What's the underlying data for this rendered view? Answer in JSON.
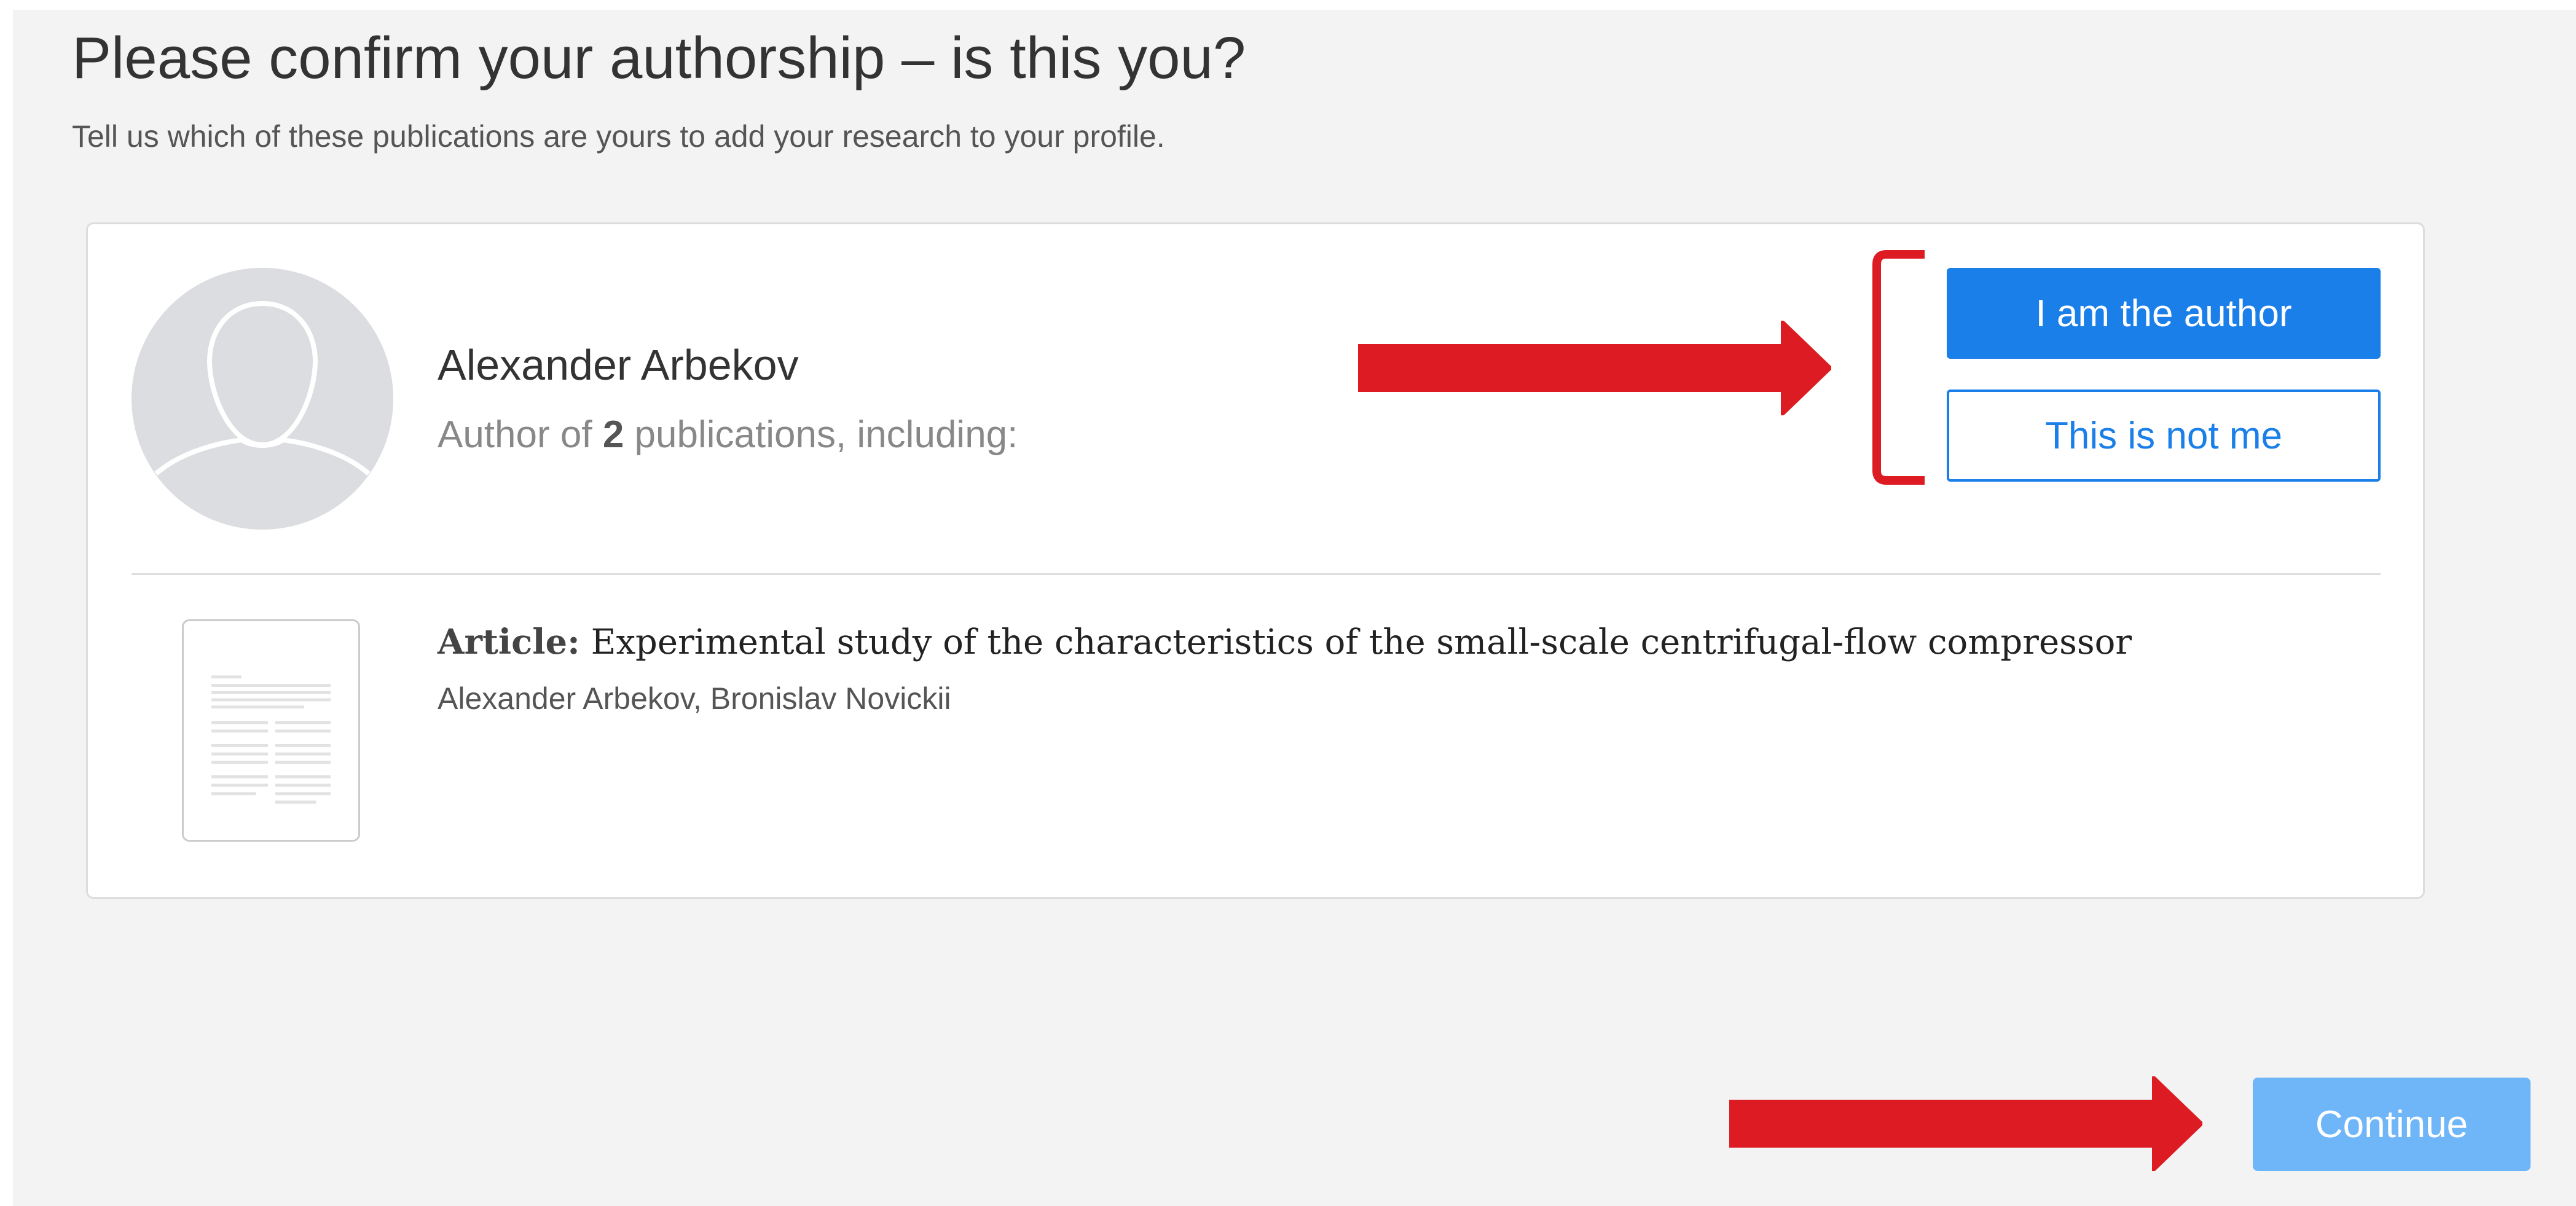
{
  "header": {
    "title": "Please confirm your authorship – is this you?",
    "subtitle": "Tell us which of these publications are yours to add your research to your profile."
  },
  "author": {
    "name": "Alexander Arbekov",
    "meta_prefix": "Author of ",
    "publication_count": "2",
    "meta_suffix": " publications, including:"
  },
  "actions": {
    "confirm_label": "I am the author",
    "reject_label": "This is not me"
  },
  "publication": {
    "type_label": "Article:",
    "title": "Experimental study of the characteristics of the small-scale centrifugal-flow compressor",
    "authors": "Alexander Arbekov, Bronislav Novickii"
  },
  "footer": {
    "continue_label": "Continue"
  },
  "colors": {
    "primary": "#1a7fe8",
    "continue_disabled": "#6fb6f8",
    "annotation_red": "#dc1c22",
    "page_background": "#f3f3f3"
  },
  "icons": {
    "avatar": "user-silhouette-icon",
    "document": "document-thumbnail-icon"
  }
}
